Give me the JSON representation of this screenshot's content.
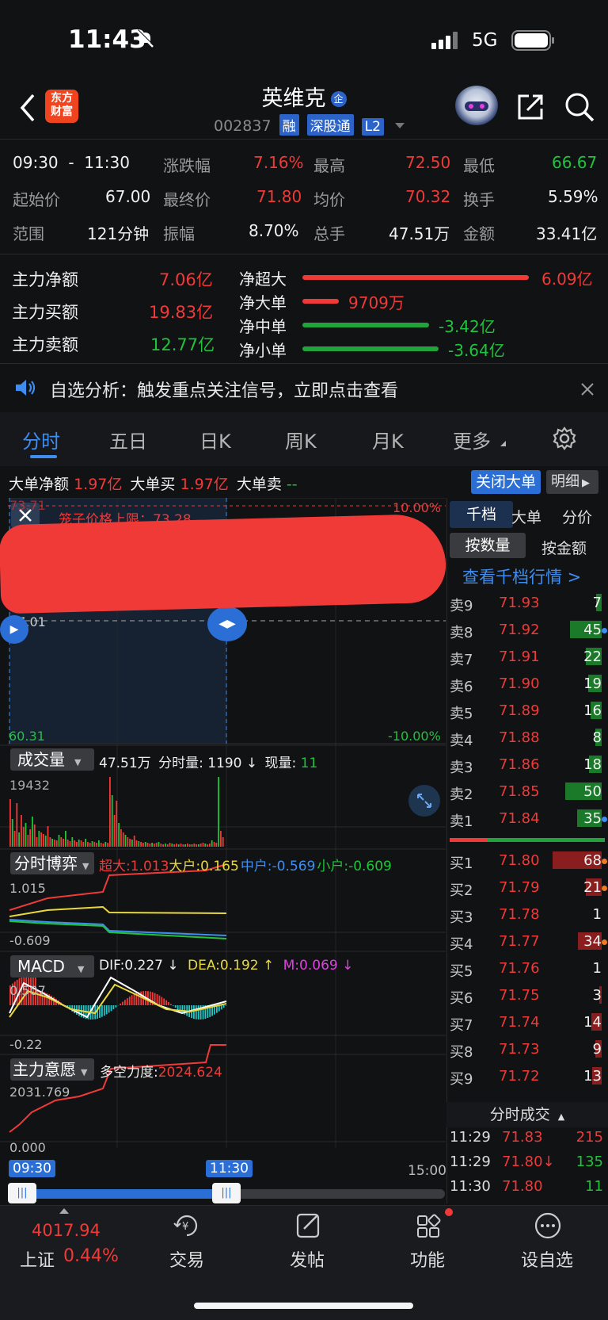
{
  "status_bar": {
    "time": "11:43",
    "network": "5G"
  },
  "header": {
    "title": "英维克",
    "badge": "企",
    "code": "002837",
    "tags": [
      "融",
      "深股通",
      "L2"
    ],
    "logo_line1": "东方",
    "logo_line2": "财富"
  },
  "quote": {
    "time_from": "09:30",
    "time_sep": "-",
    "time_to": "11:30",
    "change_pct_label": "涨跌幅",
    "change_pct": "7.16%",
    "high_label": "最高",
    "high": "72.50",
    "low_label": "最低",
    "low": "66.67",
    "start_label": "起始价",
    "start": "67.00",
    "final_label": "最终价",
    "final": "71.80",
    "avg_label": "均价",
    "avg": "70.32",
    "turnover_label": "换手",
    "turnover": "5.59%",
    "range_label": "范围",
    "range": "121分钟",
    "amplitude_label": "振幅",
    "amplitude": "8.70%",
    "volume_label": "总手",
    "volume": "47.51万",
    "amount_label": "金额",
    "amount": "33.41亿"
  },
  "capital": {
    "net_label": "主力净额",
    "net": "7.06亿",
    "buy_label": "主力买额",
    "buy": "19.83亿",
    "sell_label": "主力卖额",
    "sell": "12.77亿",
    "flows": [
      {
        "label": "净超大",
        "value": "6.09亿",
        "fraction": 1.0,
        "color": "#f03a38"
      },
      {
        "label": "净大单",
        "value": "9709万",
        "fraction": 0.16,
        "color": "#f03a38"
      },
      {
        "label": "净中单",
        "value": "-3.42亿",
        "fraction": 0.56,
        "color": "#20a33b"
      },
      {
        "label": "净小单",
        "value": "-3.64亿",
        "fraction": 0.6,
        "color": "#20a33b"
      }
    ]
  },
  "notice": {
    "text": "自选分析：触发重点关注信号，立即点击查看"
  },
  "tabs": [
    "分时",
    "五日",
    "日K",
    "周K",
    "月K",
    "更多"
  ],
  "big_order": {
    "net_label": "大单净额",
    "net": "1.97亿",
    "buy_label": "大单买",
    "buy": "1.97亿",
    "sell_label": "大单卖",
    "sell": "--",
    "close_btn": "关闭大单",
    "detail_btn": "明细"
  },
  "price_chart": {
    "top_left": "73.71",
    "cap_label": "笼子价格上限：73.28",
    "top_right": "10.00%",
    "mid": "67.01",
    "bottom_left": "60.31",
    "bottom_right": "-10.00%"
  },
  "volume_panel": {
    "selector": "成交量",
    "total": "47.51万",
    "tick_label": "分时量: 1190 ↓",
    "now_label": "现量:",
    "now": "11",
    "axis_max": "19432"
  },
  "game_panel": {
    "selector": "分时博弈",
    "super_label": "超大:1.013",
    "large_label": "大户:0.165",
    "mid_label": "中户:-0.569",
    "small_label": "小户:-0.609",
    "axis_top": "1.015",
    "axis_bottom": "-0.609"
  },
  "macd_panel": {
    "selector": "MACD",
    "dif": "DIF:0.227 ↓",
    "dea": "DEA:0.192 ↑",
    "m": "M:0.069 ↓",
    "axis_top": "0.507",
    "axis_bottom": "-0.22"
  },
  "force_panel": {
    "selector": "主力意愿",
    "label": "多空力度:",
    "value": "2024.624",
    "axis_top": "2031.769",
    "axis_bottom": "0.000"
  },
  "time_axis": {
    "start": "09:30",
    "mid": "11:30",
    "end": "15:00"
  },
  "orderbook": {
    "tabs": [
      "千档",
      "大单",
      "分价"
    ],
    "sub_tabs": [
      "按数量",
      "按金额"
    ],
    "link": "查看千档行情 >",
    "asks": [
      {
        "label": "卖9",
        "price": "71.93",
        "vol": "7",
        "bar": 0.1
      },
      {
        "label": "卖8",
        "price": "71.92",
        "vol": "45",
        "bar": 0.62
      },
      {
        "label": "卖7",
        "price": "71.91",
        "vol": "22",
        "bar": 0.3
      },
      {
        "label": "卖6",
        "price": "71.90",
        "vol": "19",
        "bar": 0.26
      },
      {
        "label": "卖5",
        "price": "71.89",
        "vol": "16",
        "bar": 0.22
      },
      {
        "label": "卖4",
        "price": "71.88",
        "vol": "8",
        "bar": 0.12
      },
      {
        "label": "卖3",
        "price": "71.86",
        "vol": "18",
        "bar": 0.25
      },
      {
        "label": "卖2",
        "price": "71.85",
        "vol": "50",
        "bar": 0.7
      },
      {
        "label": "卖1",
        "price": "71.84",
        "vol": "35",
        "bar": 0.48
      }
    ],
    "bids": [
      {
        "label": "买1",
        "price": "71.80",
        "vol": "68",
        "bar": 0.95
      },
      {
        "label": "买2",
        "price": "71.79",
        "vol": "21",
        "bar": 0.3
      },
      {
        "label": "买3",
        "price": "71.78",
        "vol": "1",
        "bar": 0.02
      },
      {
        "label": "买4",
        "price": "71.77",
        "vol": "34",
        "bar": 0.46
      },
      {
        "label": "买5",
        "price": "71.76",
        "vol": "1",
        "bar": 0.02
      },
      {
        "label": "买6",
        "price": "71.75",
        "vol": "3",
        "bar": 0.05
      },
      {
        "label": "买7",
        "price": "71.74",
        "vol": "14",
        "bar": 0.2
      },
      {
        "label": "买8",
        "price": "71.73",
        "vol": "9",
        "bar": 0.13
      },
      {
        "label": "买9",
        "price": "71.72",
        "vol": "13",
        "bar": 0.18
      }
    ],
    "trades_header": "分时成交",
    "trades": [
      {
        "time": "11:29",
        "price": "71.83",
        "vol": "215"
      },
      {
        "time": "11:29",
        "price": "71.80↓",
        "vol": "135"
      },
      {
        "time": "11:30",
        "price": "71.80",
        "vol": "11"
      }
    ]
  },
  "bottom_nav": {
    "index_value": "4017.94",
    "index_name": "上证",
    "index_change": "0.44%",
    "trade": "交易",
    "post": "发帖",
    "function": "功能",
    "add": "设自选"
  },
  "colors": {
    "up": "#f03a38",
    "down": "#20c33b",
    "accent": "#2f7ee8",
    "bg": "#111214"
  }
}
